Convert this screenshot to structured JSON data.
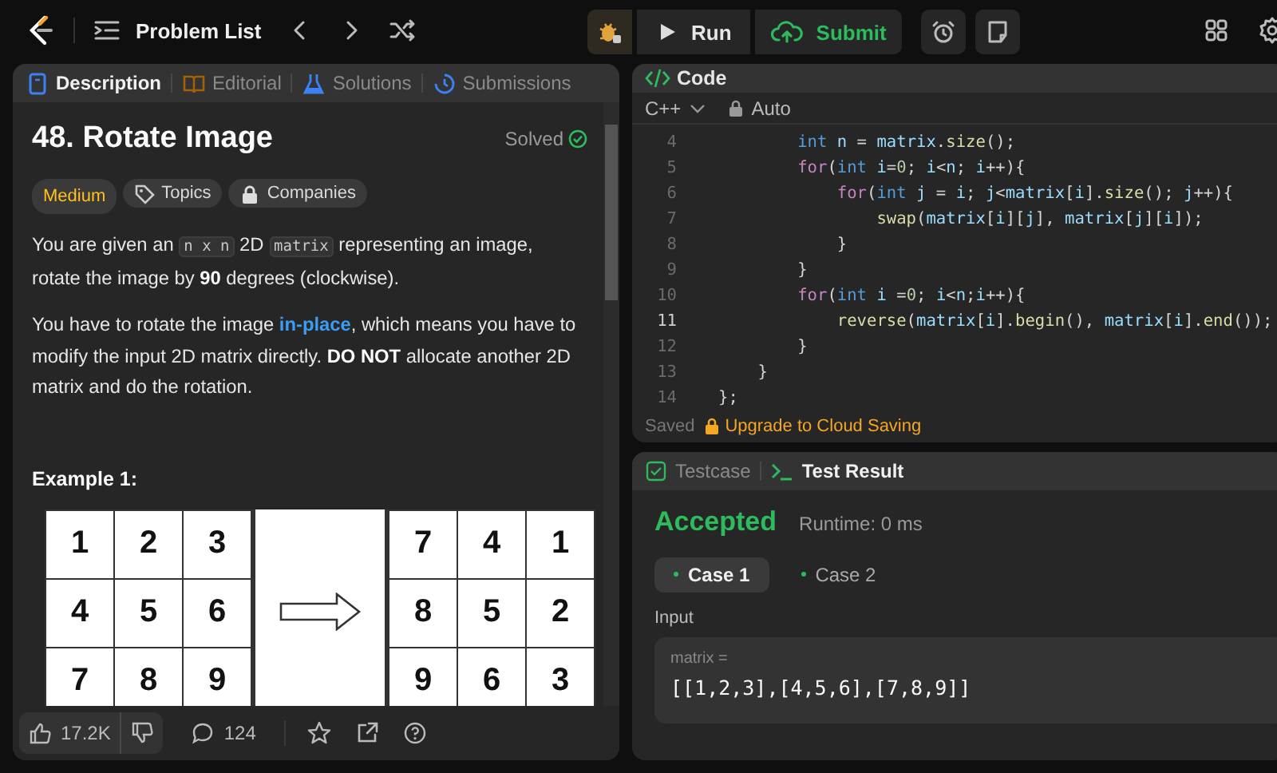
{
  "topbar": {
    "problem_list": "Problem List",
    "run": "Run",
    "submit": "Submit"
  },
  "description_tabs": [
    {
      "label": "Description",
      "selected": true,
      "color": "#3b82f6"
    },
    {
      "label": "Editorial",
      "selected": false,
      "color": "#a16207"
    },
    {
      "label": "Solutions",
      "selected": false,
      "color": "#3b82f6"
    },
    {
      "label": "Submissions",
      "selected": false,
      "color": "#3b82f6"
    }
  ],
  "problem": {
    "title": "48. Rotate Image",
    "status": "Solved",
    "difficulty": "Medium",
    "tags": [
      "Topics",
      "Companies"
    ],
    "paragraphs": [
      [
        {
          "kind": "text",
          "text": "You are given an "
        },
        {
          "kind": "code",
          "text": "n x n"
        },
        {
          "kind": "text",
          "text": " 2D "
        },
        {
          "kind": "code",
          "text": "matrix"
        },
        {
          "kind": "text",
          "text": " representing an image, rotate the image by **90** degrees (clockwise)."
        }
      ],
      [
        {
          "kind": "text",
          "text": "You have to rotate the image "
        },
        {
          "kind": "link",
          "text": "in-place"
        },
        {
          "kind": "text",
          "text": ", which means you have to modify the input 2D matrix directly. **DO NOT** allocate another 2D matrix and do the rotation."
        }
      ]
    ],
    "example_heading": "Example 1:",
    "example_before": [
      [
        "1",
        "2",
        "3"
      ],
      [
        "4",
        "5",
        "6"
      ],
      [
        "7",
        "8",
        "9"
      ]
    ],
    "example_after": [
      [
        "7",
        "4",
        "1"
      ],
      [
        "8",
        "5",
        "2"
      ],
      [
        "9",
        "6",
        "3"
      ]
    ]
  },
  "footer": {
    "likes": "17.2K",
    "comments": "124"
  },
  "code_panel": {
    "title": "Code",
    "language": "C++",
    "mode": "Auto",
    "lines": [
      {
        "number": "4",
        "current": false,
        "tokens": [
          {
            "kind": "keyword",
            "text": "        int"
          },
          {
            "kind": "var",
            "text": " n"
          },
          {
            "kind": "plain",
            "text": " = "
          },
          {
            "kind": "var",
            "text": "matrix"
          },
          {
            "kind": "plain",
            "text": "."
          },
          {
            "kind": "fn",
            "text": "size"
          },
          {
            "kind": "plain",
            "text": "();"
          }
        ]
      },
      {
        "number": "5",
        "current": false,
        "tokens": [
          {
            "kind": "control",
            "text": "        for"
          },
          {
            "kind": "plain",
            "text": "("
          },
          {
            "kind": "keyword",
            "text": "int"
          },
          {
            "kind": "var",
            "text": " i"
          },
          {
            "kind": "plain",
            "text": "="
          },
          {
            "kind": "number",
            "text": "0"
          },
          {
            "kind": "plain",
            "text": "; "
          },
          {
            "kind": "var",
            "text": "i"
          },
          {
            "kind": "plain",
            "text": "<"
          },
          {
            "kind": "var",
            "text": "n"
          },
          {
            "kind": "plain",
            "text": "; "
          },
          {
            "kind": "var",
            "text": "i"
          },
          {
            "kind": "plain",
            "text": "++){"
          }
        ]
      },
      {
        "number": "6",
        "current": false,
        "tokens": [
          {
            "kind": "control",
            "text": "            for"
          },
          {
            "kind": "plain",
            "text": "("
          },
          {
            "kind": "keyword",
            "text": "int"
          },
          {
            "kind": "var",
            "text": " j"
          },
          {
            "kind": "plain",
            "text": " = "
          },
          {
            "kind": "var",
            "text": "i"
          },
          {
            "kind": "plain",
            "text": "; "
          },
          {
            "kind": "var",
            "text": "j"
          },
          {
            "kind": "plain",
            "text": "<"
          },
          {
            "kind": "var",
            "text": "matrix"
          },
          {
            "kind": "plain",
            "text": "["
          },
          {
            "kind": "var",
            "text": "i"
          },
          {
            "kind": "plain",
            "text": "]."
          },
          {
            "kind": "fn",
            "text": "size"
          },
          {
            "kind": "plain",
            "text": "(); "
          },
          {
            "kind": "var",
            "text": "j"
          },
          {
            "kind": "plain",
            "text": "++){"
          }
        ]
      },
      {
        "number": "7",
        "current": false,
        "tokens": [
          {
            "kind": "fn",
            "text": "                swap"
          },
          {
            "kind": "plain",
            "text": "("
          },
          {
            "kind": "var",
            "text": "matrix"
          },
          {
            "kind": "plain",
            "text": "["
          },
          {
            "kind": "var",
            "text": "i"
          },
          {
            "kind": "plain",
            "text": "]["
          },
          {
            "kind": "var",
            "text": "j"
          },
          {
            "kind": "plain",
            "text": "], "
          },
          {
            "kind": "var",
            "text": "matrix"
          },
          {
            "kind": "plain",
            "text": "["
          },
          {
            "kind": "var",
            "text": "j"
          },
          {
            "kind": "plain",
            "text": "]["
          },
          {
            "kind": "var",
            "text": "i"
          },
          {
            "kind": "plain",
            "text": "]);"
          }
        ]
      },
      {
        "number": "8",
        "current": false,
        "tokens": [
          {
            "kind": "plain",
            "text": "            }"
          }
        ]
      },
      {
        "number": "9",
        "current": false,
        "tokens": [
          {
            "kind": "plain",
            "text": "        }"
          }
        ]
      },
      {
        "number": "10",
        "current": false,
        "tokens": [
          {
            "kind": "control",
            "text": "        for"
          },
          {
            "kind": "plain",
            "text": "("
          },
          {
            "kind": "keyword",
            "text": "int"
          },
          {
            "kind": "var",
            "text": " i"
          },
          {
            "kind": "plain",
            "text": " ="
          },
          {
            "kind": "number",
            "text": "0"
          },
          {
            "kind": "plain",
            "text": "; "
          },
          {
            "kind": "var",
            "text": "i"
          },
          {
            "kind": "plain",
            "text": "<"
          },
          {
            "kind": "var",
            "text": "n"
          },
          {
            "kind": "plain",
            "text": ";"
          },
          {
            "kind": "var",
            "text": "i"
          },
          {
            "kind": "plain",
            "text": "++){"
          }
        ]
      },
      {
        "number": "11",
        "current": true,
        "tokens": [
          {
            "kind": "fn",
            "text": "            reverse"
          },
          {
            "kind": "plain",
            "text": "("
          },
          {
            "kind": "var",
            "text": "matrix"
          },
          {
            "kind": "plain",
            "text": "["
          },
          {
            "kind": "var",
            "text": "i"
          },
          {
            "kind": "plain",
            "text": "]."
          },
          {
            "kind": "fn",
            "text": "begin"
          },
          {
            "kind": "plain",
            "text": "(), "
          },
          {
            "kind": "var",
            "text": "matrix"
          },
          {
            "kind": "plain",
            "text": "["
          },
          {
            "kind": "var",
            "text": "i"
          },
          {
            "kind": "plain",
            "text": "]."
          },
          {
            "kind": "fn",
            "text": "end"
          },
          {
            "kind": "plain",
            "text": "());"
          }
        ]
      },
      {
        "number": "12",
        "current": false,
        "tokens": [
          {
            "kind": "plain",
            "text": "        }"
          }
        ]
      },
      {
        "number": "13",
        "current": false,
        "tokens": [
          {
            "kind": "plain",
            "text": "    }"
          }
        ]
      },
      {
        "number": "14",
        "current": false,
        "tokens": [
          {
            "kind": "plain",
            "text": "};"
          }
        ]
      }
    ],
    "saved": "Saved",
    "upgrade": "Upgrade to Cloud Saving"
  },
  "result_tabs": [
    {
      "label": "Testcase",
      "selected": false
    },
    {
      "label": "Test Result",
      "selected": true
    }
  ],
  "result": {
    "verdict": "Accepted",
    "runtime": "Runtime: 0 ms",
    "cases": [
      {
        "label": "Case 1",
        "selected": true
      },
      {
        "label": "Case 2",
        "selected": false
      }
    ],
    "input_label": "Input",
    "variable": "matrix =",
    "value": "[[1,2,3],[4,5,6],[7,8,9]]"
  }
}
